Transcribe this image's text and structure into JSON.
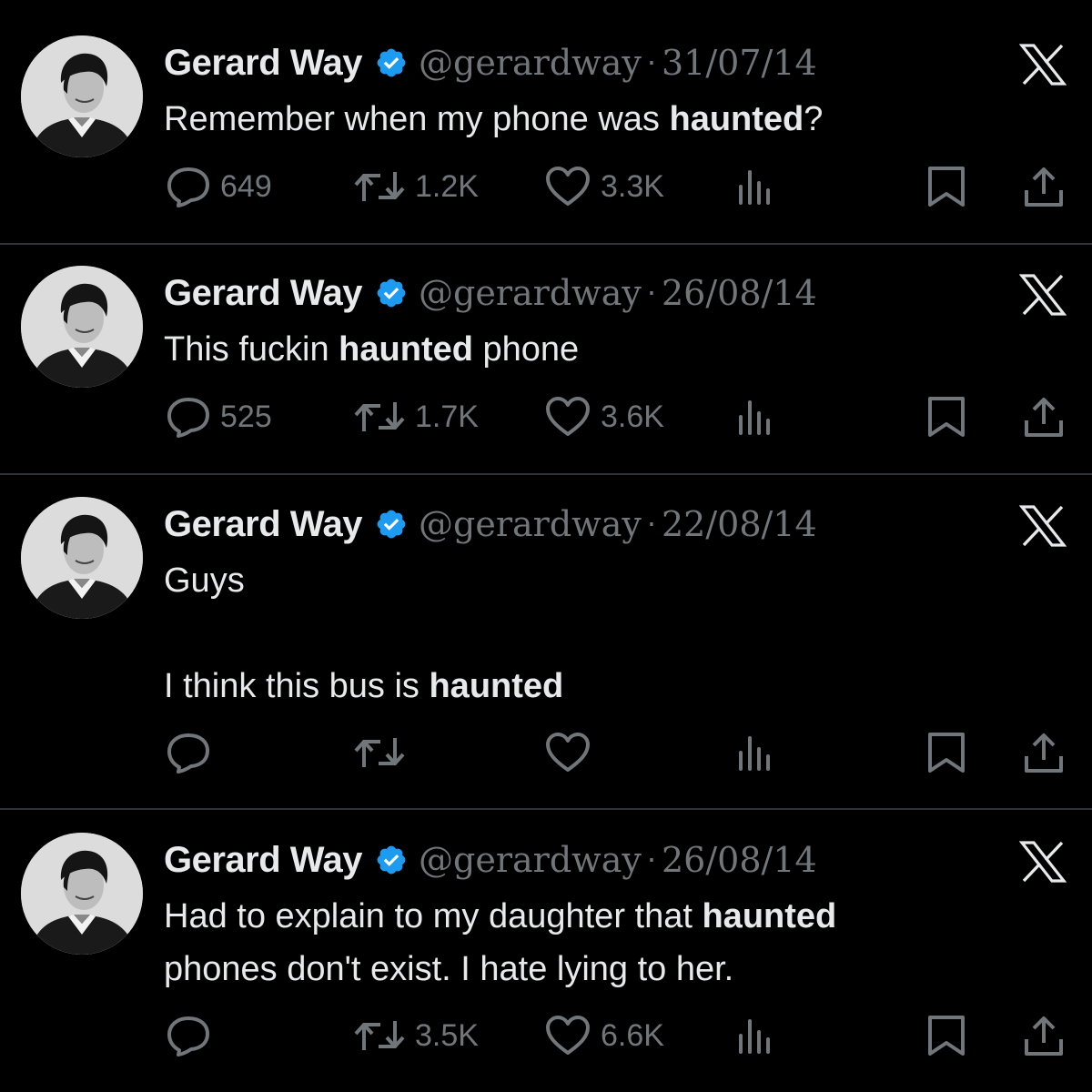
{
  "tweets": [
    {
      "author": "Gerard Way",
      "handle": "@gerardway",
      "separator": "·",
      "date": "31/07/14",
      "lines": [
        [
          {
            "t": "Remember when my phone was "
          },
          {
            "t": "haunted",
            "b": true
          },
          {
            "t": "?"
          }
        ]
      ],
      "replies": "649",
      "reposts": "1.2K",
      "likes": "3.3K"
    },
    {
      "author": "Gerard Way",
      "handle": "@gerardway",
      "separator": "·",
      "date": "26/08/14",
      "lines": [
        [
          {
            "t": "This fuckin "
          },
          {
            "t": "haunted",
            "b": true
          },
          {
            "t": " phone"
          }
        ]
      ],
      "replies": "525",
      "reposts": "1.7K",
      "likes": "3.6K"
    },
    {
      "author": "Gerard Way",
      "handle": "@gerardway",
      "separator": "·",
      "date": "22/08/14",
      "lines": [
        [
          {
            "t": "Guys"
          }
        ],
        [],
        [
          {
            "t": "I think this bus is "
          },
          {
            "t": "haunted",
            "b": true
          }
        ]
      ],
      "replies": "",
      "reposts": "",
      "likes": ""
    },
    {
      "author": "Gerard Way",
      "handle": "@gerardway",
      "separator": "·",
      "date": "26/08/14",
      "lines": [
        [
          {
            "t": "Had to explain to my daughter that "
          },
          {
            "t": "haunted",
            "b": true
          }
        ],
        [
          {
            "t": "phones don't exist. I hate lying to her."
          }
        ]
      ],
      "replies": "",
      "reposts": "3.5K",
      "likes": "6.6K"
    }
  ],
  "icons": {
    "verified": "verified-badge-icon",
    "brand": "x-logo-icon",
    "reply": "reply-bubble-icon",
    "repost": "repost-arrows-icon",
    "like": "heart-icon",
    "views": "views-bars-icon",
    "bookmark": "bookmark-icon",
    "share": "share-upload-icon"
  },
  "colors": {
    "background": "#000000",
    "text": "#e7e9ea",
    "muted": "#71767b",
    "divider": "#2f3336",
    "verified": "#1d9bf0"
  }
}
